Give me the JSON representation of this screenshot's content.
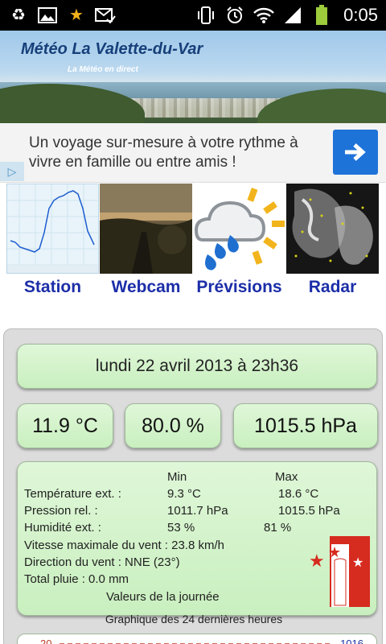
{
  "status_bar": {
    "time": "0:05",
    "left_icons": [
      "recycle-icon",
      "image-icon",
      "star-icon",
      "mail-check-icon"
    ],
    "right_icons": [
      "vibrate-icon",
      "alarm-icon",
      "wifi-icon",
      "signal-icon",
      "battery-icon"
    ]
  },
  "header": {
    "title": "Météo La Valette-du-Var",
    "subtitle": "La Météo en direct"
  },
  "ad": {
    "text": "Un voyage sur-mesure à votre rythme à vivre en famille ou entre amis !"
  },
  "nav": {
    "items": [
      {
        "label": "Station"
      },
      {
        "label": "Webcam"
      },
      {
        "label": "Prévisions"
      },
      {
        "label": "Radar"
      }
    ]
  },
  "weather": {
    "datetime": "lundi 22 avril 2013 à 23h36",
    "temperature": "11.9 °C",
    "humidity": "80.0 %",
    "pressure": "1015.5 hPa",
    "stats": {
      "col_min": "Min",
      "col_max": "Max",
      "temp_label": "Température ext. :",
      "temp_min": "9.3 °C",
      "temp_max": "18.6 °C",
      "press_label": "Pression rel. :",
      "press_min": "1011.7 hPa",
      "press_max": "1015.5 hPa",
      "hum_label": "Humidité ext. :",
      "hum_min": "53 %",
      "hum_max": "81 %",
      "wind_speed": "Vitesse maximale du vent : 23.8 km/h",
      "wind_dir": "Direction du vent : NNE (23°)",
      "rain": "Total pluie : 0.0 mm",
      "day_values": "Valeurs de la journée"
    },
    "graph_title": "Graphique des 24 dernières heures",
    "graph_left": "20",
    "graph_right": "1016"
  },
  "colors": {
    "accent": "#1c2ea8",
    "box_green": "#c9efbf",
    "ad_button": "#1e73d8"
  }
}
